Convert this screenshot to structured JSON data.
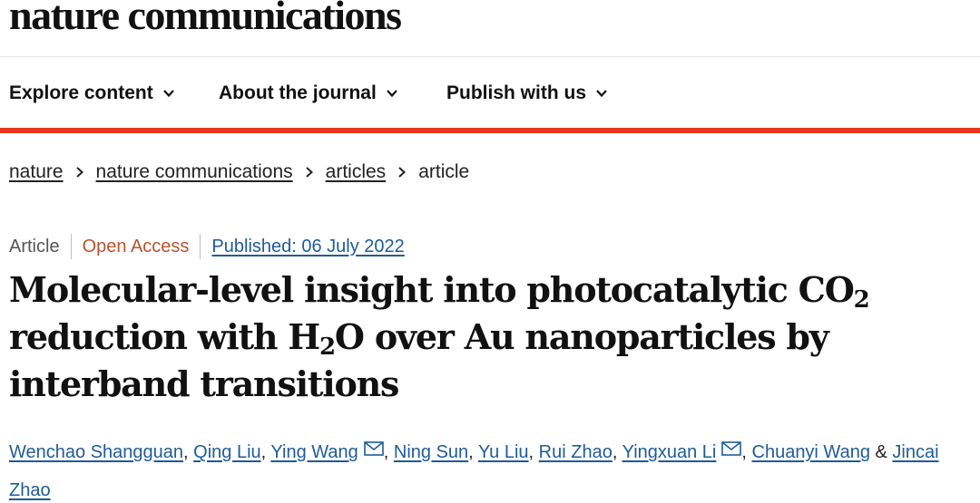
{
  "journal": {
    "name": "nature communications"
  },
  "nav": {
    "items": [
      {
        "label": "Explore content"
      },
      {
        "label": "About the journal"
      },
      {
        "label": "Publish with us"
      }
    ]
  },
  "breadcrumb": {
    "items": [
      {
        "label": "nature"
      },
      {
        "label": "nature communications"
      },
      {
        "label": "articles"
      },
      {
        "label": "article"
      }
    ]
  },
  "meta": {
    "type": "Article",
    "access": "Open Access",
    "published": "Published: 06 July 2022"
  },
  "article": {
    "title_part1": "Molecular-level insight into photocatalytic CO",
    "title_sub1": "2",
    "title_part2": " reduction with H",
    "title_sub2": "2",
    "title_part3": "O over Au nanoparticles by interband transitions"
  },
  "authors": {
    "list": [
      "Wenchao Shangguan",
      "Qing Liu",
      "Ying Wang",
      "Ning Sun",
      "Yu Liu",
      "Rui Zhao",
      "Yingxuan Li",
      "Chuanyi Wang",
      "Jincai Zhao"
    ],
    "separator": ", ",
    "and": " & "
  },
  "icons": {
    "chevron": "chevron-down-icon",
    "breadcrumb_separator": "chevron-right-icon",
    "email": "mail-icon"
  },
  "colors": {
    "accent_red": "#e8351e",
    "link_blue": "#1f5b99",
    "open_access": "#b7532f"
  }
}
